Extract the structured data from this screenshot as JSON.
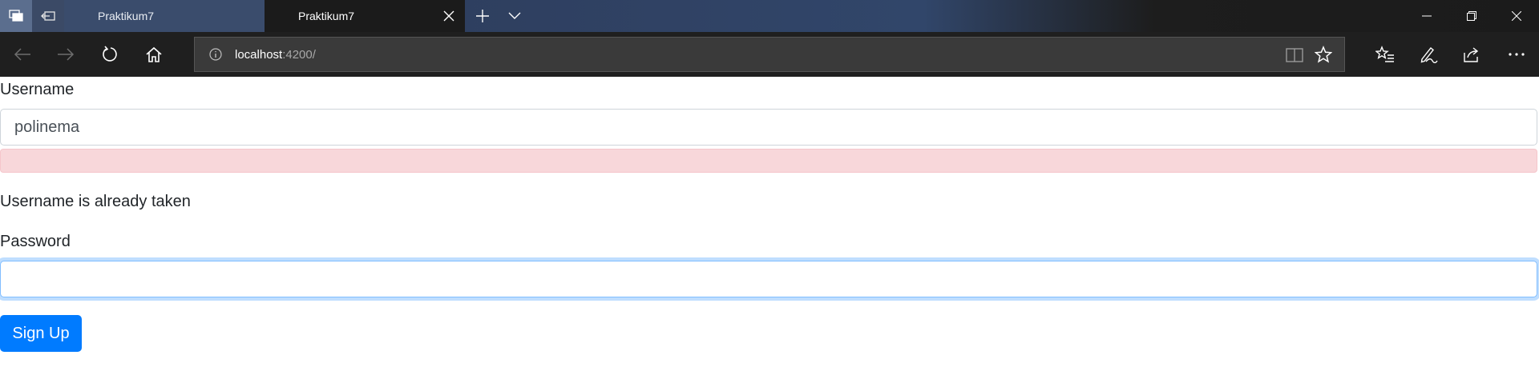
{
  "browser": {
    "tabs": [
      {
        "title": "Praktikum7",
        "active": false
      },
      {
        "title": "Praktikum7",
        "active": true
      }
    ],
    "address": {
      "host": "localhost",
      "path": ":4200/"
    },
    "icons": {
      "tab_manager": "tabs-aside-icon",
      "set_aside": "set-aside-tabs-icon",
      "close_tab": "close-icon",
      "new_tab": "plus-icon",
      "tab_preview": "chevron-down-icon",
      "back": "arrow-left-icon",
      "forward": "arrow-right-icon",
      "refresh": "refresh-icon",
      "home": "home-icon",
      "info": "info-icon",
      "reading_view": "book-icon",
      "favorite": "star-icon",
      "favorites_hub": "favorites-list-icon",
      "notes": "pen-icon",
      "share": "share-icon",
      "more": "more-icon",
      "minimize": "minimize-icon",
      "maximize": "restore-icon",
      "close_window": "close-window-icon"
    }
  },
  "form": {
    "username_label": "Username",
    "username_value": "polinema",
    "error_message": "Username is already taken",
    "password_label": "Password",
    "password_value": "",
    "submit_label": "Sign Up"
  },
  "colors": {
    "primary": "#007bff",
    "alert_bg": "#f8d7da",
    "focus_ring": "#80bdff"
  }
}
